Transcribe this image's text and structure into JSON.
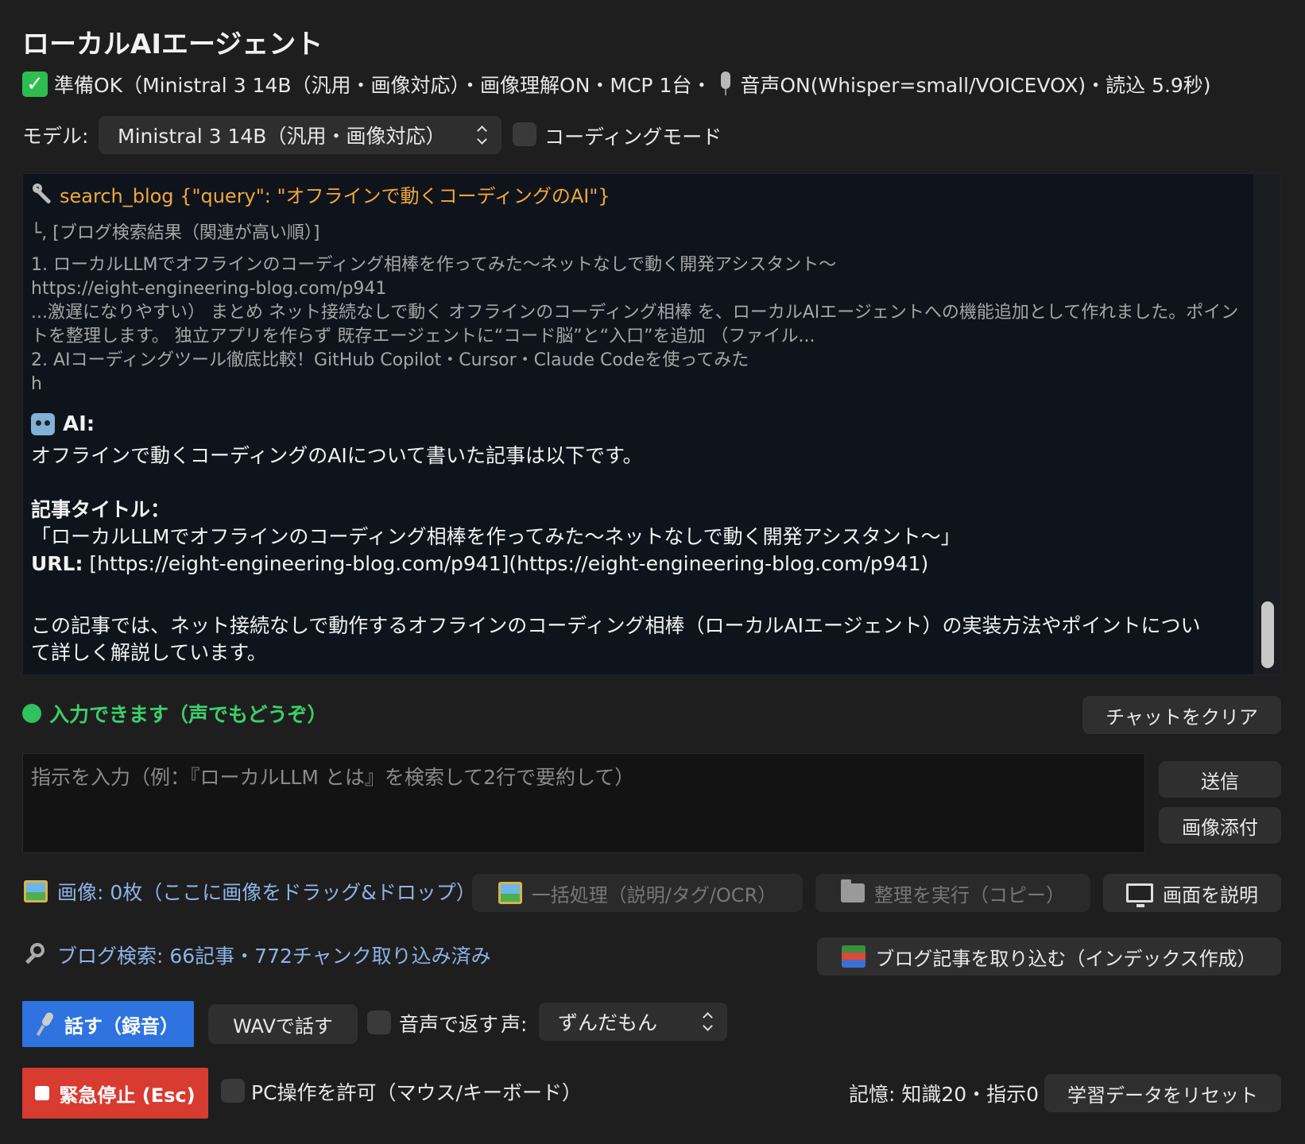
{
  "app": {
    "title": "ローカルAIエージェント",
    "status_prefix": "準備OK（Ministral 3 14B（汎用・画像対応）・画像理解ON・MCP 1台・",
    "status_suffix": "音声ON(Whisper=small/VOICEVOX)・読込 5.9秒)"
  },
  "model": {
    "label": "モデル:",
    "selected": "Ministral 3 14B（汎用・画像対応）",
    "coding_mode_label": "コーディングモード",
    "coding_mode_checked": false
  },
  "chat": {
    "tool_call": "search_blog {\"query\": \"オフラインで動くコーディングのAI\"}",
    "result_lines": [
      "└, [ブログ検索結果（関連が高い順）]",
      "1. ローカルLLMでオフラインのコーディング相棒を作ってみた〜ネットなしで動く開発アシスタント〜",
      "https://eight-engineering-blog.com/p941",
      "...激遅になりやすい） まとめ ネット接続なしで動く オフラインのコーディング相棒 を、ローカルAIエージェントへの機能追加として作れました。ポイン",
      "トを整理します。 独立アプリを作らず 既存エージェントに“コード脳”と“入口”を追加 （ファイル...",
      "2. AIコーディングツール徹底比較！GitHub Copilot・Cursor・Claude Codeを使ってみた",
      "h"
    ],
    "ai_label": "AI:",
    "ai_intro": "オフラインで動くコーディングのAIについて書いた記事は以下です。",
    "article_heading": "記事タイトル：",
    "article_title": "「ローカルLLMでオフラインのコーディング相棒を作ってみた〜ネットなしで動く開発アシスタント〜」",
    "url_label": "URL:",
    "url_value": " [https://eight-engineering-blog.com/p941](https://eight-engineering-blog.com/p941)",
    "summary_line1": "この記事では、ネット接続なしで動作するオフラインのコーディング相棒（ローカルAIエージェント）の実装方法やポイントについ",
    "summary_line2": "て詳しく解説しています。"
  },
  "input_status": "入力できます（声でもどうぞ）",
  "clear_chat_button": "チャットをクリア",
  "input": {
    "placeholder": "指示を入力（例：『ローカルLLM とは』を検索して2行で要約して）",
    "send_button": "送信",
    "attach_image_button": "画像添付"
  },
  "images": {
    "count_label": "画像: 0枚（ここに画像をドラッグ&ドロップ）",
    "batch_button": "一括処理（説明/タグ/OCR）",
    "organize_button": "整理を実行（コピー）",
    "describe_screen_button": "画面を説明"
  },
  "blog": {
    "status": "ブログ検索: 66記事・772チャンク取り込み済み",
    "import_button": "ブログ記事を取り込む（インデックス作成）"
  },
  "voice": {
    "talk_button": "話す（録音）",
    "wav_button": "WAVで話す",
    "voice_reply_label": "音声で返す",
    "voice_reply_checked": false,
    "voice_label": "声:",
    "voice_selected": "ずんだもん"
  },
  "controls": {
    "stop_button": "緊急停止 (Esc)",
    "pc_control_label": "PC操作を許可（マウス/キーボード）",
    "pc_control_checked": false,
    "memory_label": "記憶: 知識20・指示0",
    "reset_button": "学習データをリセット"
  },
  "colors": {
    "accent_blue": "#2e73e0",
    "stop_red": "#d83b30",
    "ready_green": "#3ccf6b",
    "tool_orange": "#f0a73c",
    "link_blue": "#8db3e8"
  }
}
